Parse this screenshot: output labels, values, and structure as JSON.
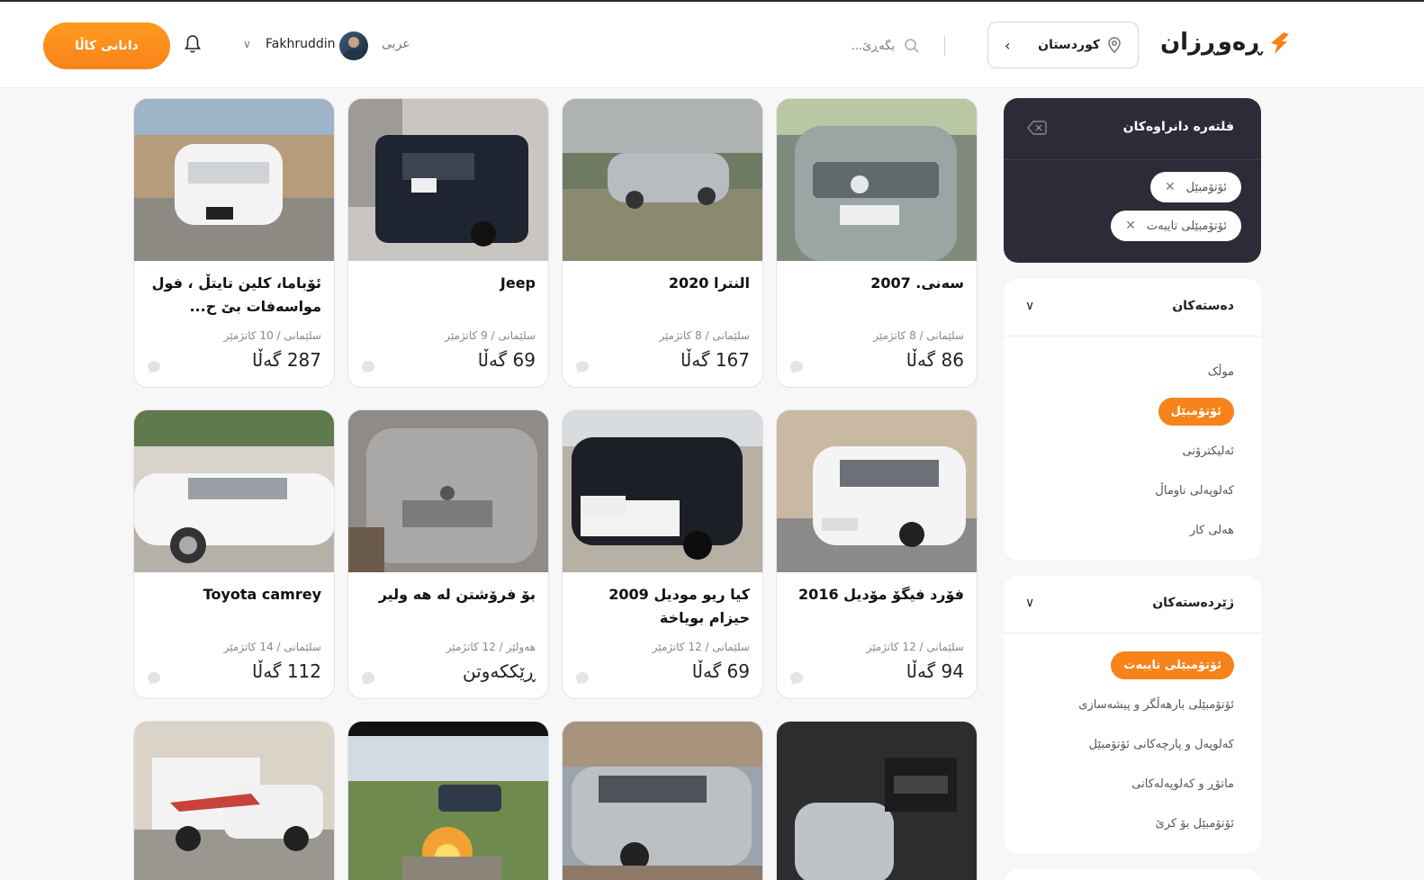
{
  "header": {
    "logo_text": "ڕەوڕزان",
    "location_label": "کوردستان",
    "search_placeholder": "بگەڕێ...",
    "language": "عربی",
    "username": "Fakhruddin",
    "post_button": "دانانی کاڵا"
  },
  "filters": {
    "title": "فلتەرە دانراوەکان",
    "chips": [
      {
        "label": "ئۆتۆمبێل"
      },
      {
        "label": "ئۆتۆمبێلی تایبەت"
      }
    ]
  },
  "categories": {
    "title": "دەستەکان",
    "items": [
      "موڵک",
      "ئۆتۆمبێل",
      "ئەلیکترۆنی",
      "کەلوپەلی ناوماڵ",
      "هەلی کار"
    ],
    "active_index": 1
  },
  "subcategories": {
    "title": "ژێردەستەکان",
    "items": [
      "ئۆتۆمبێلی تایبەت",
      "ئۆتۆمبێلی بارهەڵگر و پیشەسازی",
      "کەلوپەل و پارچەکانی ئۆتۆمبێل",
      "ماتۆڕ و کەلوپەلەکانی",
      "ئۆتۆمبێل بۆ کرێ"
    ],
    "active_index": 0
  },
  "listings": [
    {
      "title": "سەنی. 2007",
      "location": "سلێمانی / 8 کاتژمێر",
      "price": "86 گەڵا"
    },
    {
      "title": "النترا 2020",
      "location": "سلێمانی / 8 کاتژمێر",
      "price": "167 گەڵا"
    },
    {
      "title": "Jeep",
      "location": "سلێمانی / 9 کاتژمێر",
      "price": "69 گەڵا"
    },
    {
      "title": "ئۆباما، کلین تایتڵ ، فول مواسەفات بێ ح...",
      "location": "سلێمانی / 10 کاتژمێر",
      "price": "287 گەڵا"
    },
    {
      "title": "فۆرد فیگۆ مۆدیل 2016",
      "location": "سلێمانی / 12 کاتژمێر",
      "price": "94 گەڵا"
    },
    {
      "title": "کیا ریو مودیل 2009 حیزام بویاخة",
      "location": "سلێمانی / 12 کاتژمێر",
      "price": "69 گەڵا"
    },
    {
      "title": "بۆ فرۆشتن له هه ولیر",
      "location": "هەولێر / 12 کاتژمێر",
      "price": "ڕێککەوتن"
    },
    {
      "title": "Toyota camrey",
      "location": "سلێمانی / 14 کاتژمێر",
      "price": "112 گەڵا"
    }
  ],
  "colors": {
    "accent": "#f7831b",
    "dark_panel": "#2f2a38"
  }
}
